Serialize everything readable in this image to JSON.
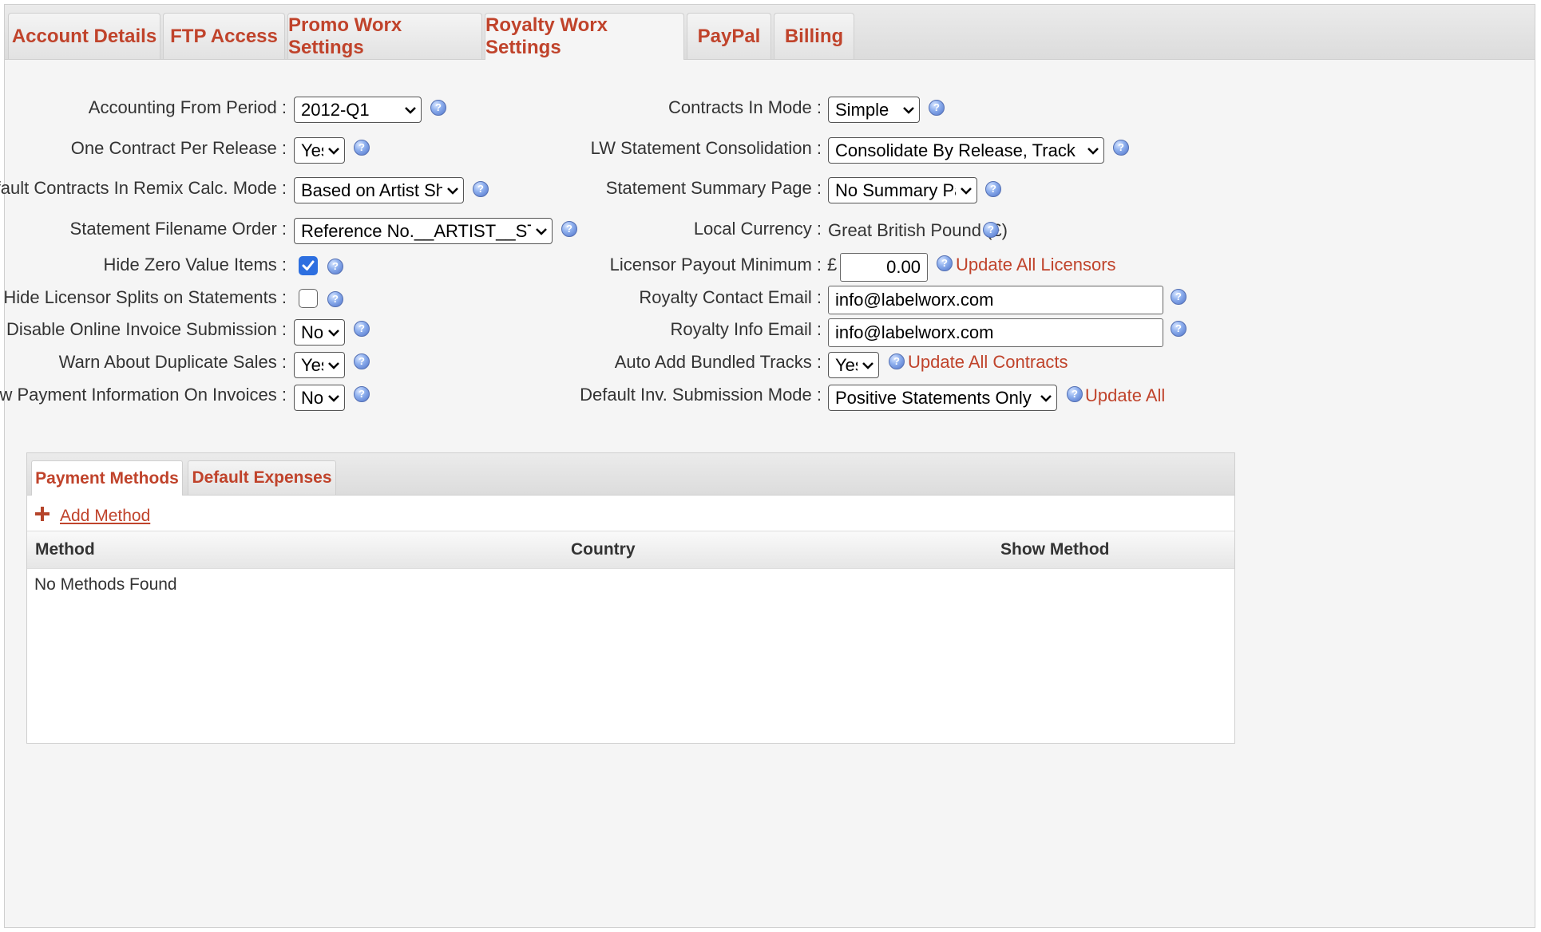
{
  "tabs": [
    {
      "label": "Account Details"
    },
    {
      "label": "FTP Access"
    },
    {
      "label": "Promo Worx Settings"
    },
    {
      "label": "Royalty Worx Settings"
    },
    {
      "label": "PayPal"
    },
    {
      "label": "Billing"
    }
  ],
  "active_tab": "Royalty Worx Settings",
  "left": {
    "accounting_from_period": {
      "label": "Accounting From Period :",
      "value": "2012-Q1"
    },
    "one_contract_per_release": {
      "label": "One Contract Per Release :",
      "value": "Yes"
    },
    "default_contracts_remix": {
      "label": "Default Contracts In Remix Calc. Mode :",
      "value": "Based on Artist Share"
    },
    "statement_filename_order": {
      "label": "Statement Filename Order :",
      "value": "Reference No.__ARTIST__STATEM"
    },
    "hide_zero_value_items": {
      "label": "Hide Zero Value Items :",
      "checked": true
    },
    "hide_licensor_splits": {
      "label": "Hide Licensor Splits on Statements :",
      "checked": false
    },
    "disable_online_invoice": {
      "label": "Disable Online Invoice Submission :",
      "value": "No"
    },
    "warn_duplicate_sales": {
      "label": "Warn About Duplicate Sales :",
      "value": "Yes"
    },
    "show_payment_info": {
      "label": "Show Payment Information On Invoices :",
      "value": "No"
    }
  },
  "right": {
    "contracts_in_mode": {
      "label": "Contracts In Mode :",
      "value": "Simple"
    },
    "lw_statement_consolidation": {
      "label": "LW Statement Consolidation :",
      "value": "Consolidate By Release, Track"
    },
    "statement_summary_page": {
      "label": "Statement Summary Page :",
      "value": "No Summary Page"
    },
    "local_currency": {
      "label": "Local Currency :",
      "value": "Great British Pound (£)"
    },
    "licensor_payout_minimum": {
      "label": "Licensor Payout Minimum :",
      "currency_symbol": "£",
      "value": "0.00",
      "link": "Update All Licensors"
    },
    "royalty_contact_email": {
      "label": "Royalty Contact Email :",
      "value": "info@labelworx.com"
    },
    "royalty_info_email": {
      "label": "Royalty Info Email :",
      "value": "info@labelworx.com"
    },
    "auto_add_bundled_tracks": {
      "label": "Auto Add Bundled Tracks :",
      "value": "Yes",
      "link": "Update All Contracts"
    },
    "default_inv_submission_mode": {
      "label": "Default Inv. Submission Mode :",
      "value": "Positive Statements Only",
      "link": "Update All"
    }
  },
  "sub_tabs": [
    {
      "label": "Payment Methods"
    },
    {
      "label": "Default Expenses"
    }
  ],
  "active_sub_tab": "Payment Methods",
  "add_method_label": "Add Method",
  "table": {
    "columns": [
      "Method",
      "Country",
      "Show Method"
    ],
    "empty_message": "No Methods Found"
  },
  "colors": {
    "accent": "#c0432b",
    "checkbox": "#2d6fe0",
    "background": "#f5f5f5"
  },
  "icons": {
    "help": "help-icon",
    "add": "plus-icon",
    "dropdown": "chevron-down-icon"
  }
}
